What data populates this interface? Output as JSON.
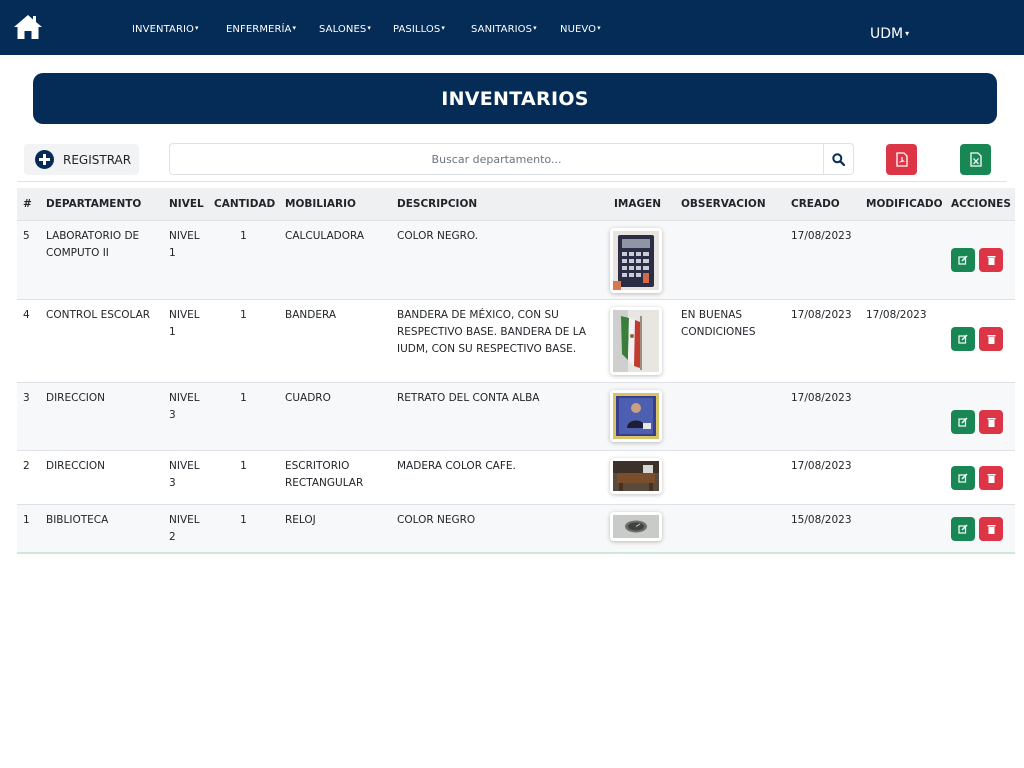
{
  "nav": {
    "items": [
      {
        "label": "INVENTARIO"
      },
      {
        "label": "ENFERMERÍA"
      },
      {
        "label": "SALONES"
      },
      {
        "label": "PASILLOS"
      },
      {
        "label": "SANITARIOS"
      },
      {
        "label": "NUEVO"
      }
    ],
    "caret": "▾",
    "user": "UDM",
    "home_icon": "home-icon"
  },
  "page": {
    "title": "INVENTARIOS"
  },
  "toolbar": {
    "register_label": "REGISTRAR",
    "search_placeholder": "Buscar departamento...",
    "pdf_icon": "file-pdf-icon",
    "excel_icon": "file-excel-icon"
  },
  "table": {
    "headers": [
      "#",
      "DEPARTAMENTO",
      "NIVEL",
      "CANTIDAD",
      "MOBILIARIO",
      "DESCRIPCION",
      "IMAGEN",
      "OBSERVACION",
      "CREADO",
      "MODIFICADO",
      "ACCIONES"
    ],
    "rows": [
      {
        "id": "5",
        "departamento": "LABORATORIO DE COMPUTO II",
        "nivel": "NIVEL 1",
        "cantidad": "1",
        "mobiliario": "CALCULADORA",
        "descripcion": "COLOR NEGRO.",
        "observacion": "",
        "creado": "17/08/2023",
        "modificado": ""
      },
      {
        "id": "4",
        "departamento": "CONTROL ESCOLAR",
        "nivel": "NIVEL 1",
        "cantidad": "1",
        "mobiliario": "BANDERA",
        "descripcion": "BANDERA DE MÉXICO, CON SU RESPECTIVO BASE. BANDERA DE LA IUDM, CON SU RESPECTIVO BASE.",
        "observacion": "EN BUENAS CONDICIONES",
        "creado": "17/08/2023",
        "modificado": "17/08/2023"
      },
      {
        "id": "3",
        "departamento": "DIRECCION",
        "nivel": "NIVEL 3",
        "cantidad": "1",
        "mobiliario": "CUADRO",
        "descripcion": "RETRATO DEL CONTA ALBA",
        "observacion": "",
        "creado": "17/08/2023",
        "modificado": ""
      },
      {
        "id": "2",
        "departamento": "DIRECCION",
        "nivel": "NIVEL 3",
        "cantidad": "1",
        "mobiliario": "ESCRITORIO RECTANGULAR",
        "descripcion": "MADERA COLOR CAFE.",
        "observacion": "",
        "creado": "17/08/2023",
        "modificado": ""
      },
      {
        "id": "1",
        "departamento": "BIBLIOTECA",
        "nivel": "NIVEL 2",
        "cantidad": "1",
        "mobiliario": "RELOJ",
        "descripcion": "COLOR NEGRO",
        "observacion": "",
        "creado": "15/08/2023",
        "modificado": ""
      }
    ]
  },
  "colors": {
    "navy": "#052c56",
    "green": "#198754",
    "red": "#dc3545"
  }
}
